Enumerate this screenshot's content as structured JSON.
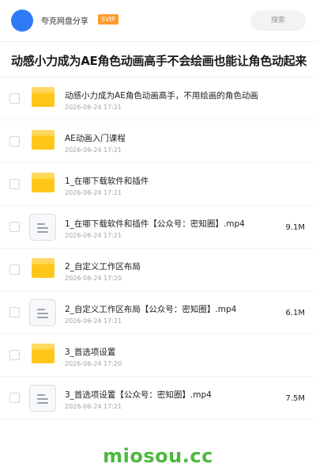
{
  "header": {
    "share_label": "夸克网盘分享",
    "badge": "SVIP",
    "search_placeholder": "搜索",
    "accent_color": "#2f7bf6",
    "badge_color": "#ff9a2e"
  },
  "page_title": "动感小力成为AE角色动画高手不会绘画也能让角色动起来",
  "files": [
    {
      "type": "folder-icon",
      "name": "动感小力成为AE角色动画高手，不用绘画的角色动画",
      "date": "2026-06-24 17:21",
      "size": ""
    },
    {
      "type": "folder-icon",
      "name": "AE动画入门课程",
      "date": "2026-06-24 17:21",
      "size": ""
    },
    {
      "type": "folder-icon",
      "name": "1_在哪下载软件和插件",
      "date": "2026-06-24 17:21",
      "size": ""
    },
    {
      "type": "video-file-icon",
      "name": "1_在哪下载软件和插件【公众号：密知圈】.mp4",
      "date": "2026-06-24 17:21",
      "size": "9.1M"
    },
    {
      "type": "folder-icon",
      "name": "2_自定义工作区布局",
      "date": "2026-06-24 17:20",
      "size": ""
    },
    {
      "type": "video-file-icon",
      "name": "2_自定义工作区布局【公众号：密知圈】.mp4",
      "date": "2026-06-24 17:21",
      "size": "6.1M"
    },
    {
      "type": "folder-icon",
      "name": "3_首选项设置",
      "date": "2026-06-24 17:20",
      "size": ""
    },
    {
      "type": "video-file-icon",
      "name": "3_首选项设置【公众号：密知圈】.mp4",
      "date": "2026-06-24 17:21",
      "size": "7.5M"
    }
  ],
  "watermark": "miosou.cc",
  "watermark_color": "#4cb83f"
}
